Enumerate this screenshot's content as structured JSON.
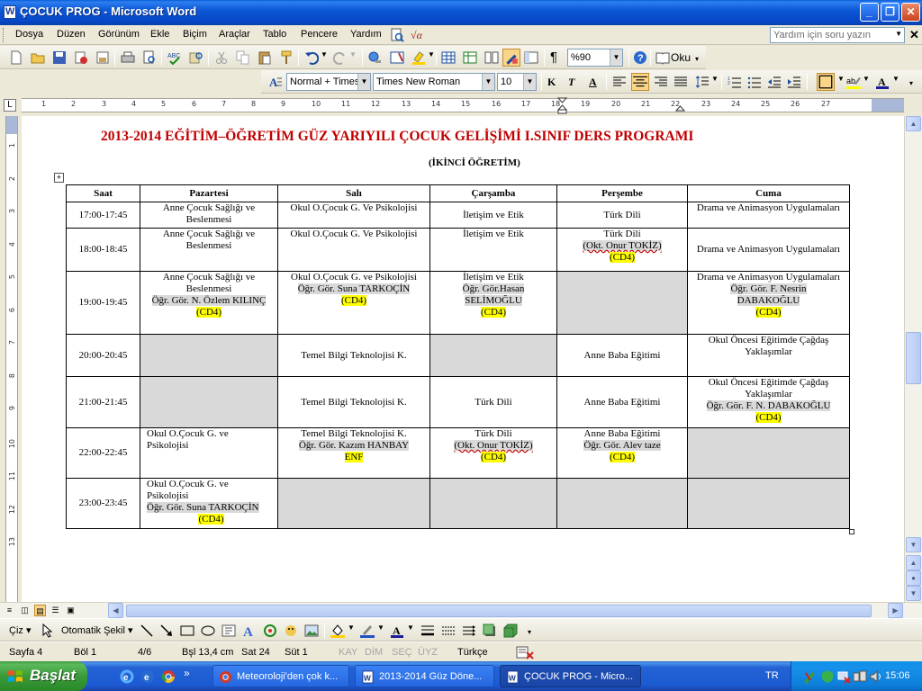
{
  "window": {
    "title": "ÇOCUK PROG - Microsoft Word"
  },
  "menu": {
    "items": [
      "Dosya",
      "Düzen",
      "Görünüm",
      "Ekle",
      "Biçim",
      "Araçlar",
      "Tablo",
      "Pencere",
      "Yardım"
    ],
    "help_placeholder": "Yardım için soru yazın"
  },
  "standard_toolbar": {
    "zoom": "%90",
    "read_label": "Oku"
  },
  "formatting_toolbar": {
    "style": "Normal + Times",
    "font": "Times New Roman",
    "size": "10"
  },
  "ruler": {
    "ticks": [
      "1",
      "2",
      "3",
      "4",
      "5",
      "6",
      "7",
      "8",
      "9",
      "10",
      "11",
      "12",
      "13",
      "14",
      "15",
      "16",
      "17",
      "18",
      "19",
      "20",
      "21",
      "22",
      "23",
      "24",
      "25",
      "26",
      "27"
    ]
  },
  "vruler": {
    "ticks": [
      "1",
      "2",
      "3",
      "4",
      "5",
      "6",
      "7",
      "8",
      "9",
      "10",
      "11",
      "12",
      "13"
    ]
  },
  "document": {
    "title": "2013-2014 EĞİTİM–ÖĞRETİM GÜZ YARIYILI ÇOCUK GELİŞİMİ I.SINIF DERS PROGRAMI",
    "subtitle": "(İKİNCİ ÖĞRETİM)",
    "table": {
      "headers": [
        "Saat",
        "Pazartesi",
        "Salı",
        "Çarşamba",
        "Perşembe",
        "Cuma"
      ],
      "rows": [
        {
          "time": "17:00-17:45",
          "mon": {
            "course": "Anne Çocuk Sağlığı ve Beslenmesi"
          },
          "tue": {
            "course": "Okul O.Çocuk G. Ve Psikolojisi"
          },
          "wed": {
            "course": "İletişim ve Etik"
          },
          "thu": {
            "course": "Türk Dili"
          },
          "fri": {
            "course": "Drama ve Animasyon Uygulamaları"
          }
        },
        {
          "time": "18:00-18:45",
          "mon": {
            "course": "Anne Çocuk Sağlığı ve Beslenmesi"
          },
          "tue": {
            "course": "Okul O.Çocuk G. Ve Psikolojisi"
          },
          "wed": {
            "course": "İletişim ve Etik"
          },
          "thu": {
            "course": "Türk Dili",
            "teacher": "(Okt. Onur TOKİZ)",
            "room": "(CD4)"
          },
          "fri": {
            "course": "Drama ve Animasyon Uygulamaları"
          }
        },
        {
          "time": "19:00-19:45",
          "mon": {
            "course": "Anne Çocuk Sağlığı ve Beslenmesi",
            "teacher": "Öğr. Gör. N. Özlem KILINÇ",
            "room": "(CD4)"
          },
          "tue": {
            "course": "Okul O.Çocuk G. ve Psikolojisi",
            "teacher": "Öğr. Gör. Suna TARKOÇİN",
            "room": "(CD4)"
          },
          "wed": {
            "course": "İletişim ve Etik",
            "teacher": "Öğr. Gör.Hasan SELİMOĞLU",
            "room": "(CD4)"
          },
          "thu": {},
          "fri": {
            "course": "Drama ve Animasyon Uygulamaları",
            "teacher": "Öğr. Gör. F. Nesrin DABAKOĞLU",
            "room": "(CD4)"
          }
        },
        {
          "time": "20:00-20:45",
          "mon": {},
          "tue": {
            "course": "Temel Bilgi Teknolojisi K."
          },
          "wed": {},
          "thu": {
            "course": "Anne Baba Eğitimi"
          },
          "fri": {
            "course": "Okul Öncesi Eğitimde Çağdaş Yaklaşımlar"
          }
        },
        {
          "time": "21:00-21:45",
          "mon": {},
          "tue": {
            "course": "Temel Bilgi Teknolojisi K."
          },
          "wed": {
            "course": "Türk Dili"
          },
          "thu": {
            "course": "Anne Baba Eğitimi"
          },
          "fri": {
            "course": "Okul Öncesi Eğitimde Çağdaş Yaklaşımlar",
            "teacher": "Öğr. Gör. F. N. DABAKOĞLU",
            "room": "(CD4)"
          }
        },
        {
          "time": "22:00-22:45",
          "mon": {
            "course": "Okul O.Çocuk G. ve Psikolojisi"
          },
          "tue": {
            "course": "Temel Bilgi Teknolojisi K.",
            "teacher": "Öğr. Gör. Kazım HANBAY",
            "room": "ENF"
          },
          "wed": {
            "course": "Türk Dili",
            "teacher": "(Okt. Onur TOKİZ)",
            "room": "(CD4)"
          },
          "thu": {
            "course": "Anne Baba Eğitimi",
            "teacher": "Öğr. Gör. Alev taze",
            "room": "(CD4)"
          },
          "fri": {}
        },
        {
          "time": "23:00-23:45",
          "mon": {
            "course": "Okul O.Çocuk G. ve Psikolojisi",
            "teacher": "Öğr. Gör. Suna TARKOÇİN",
            "room": "(CD4)"
          },
          "tue": {},
          "wed": {},
          "thu": {},
          "fri": {}
        }
      ]
    }
  },
  "drawing_toolbar": {
    "draw_label": "Çiz",
    "autoshapes_label": "Otomatik Şekil"
  },
  "status": {
    "page": "Sayfa  4",
    "section": "Böl  1",
    "pages": "4/6",
    "position": "Bşl  13,4 cm",
    "line": "Sat  24",
    "column": "Süt  1",
    "rec": "KAY",
    "trk": "DİM",
    "ext": "SEÇ",
    "ovr": "ÜYZ",
    "language": "Türkçe"
  },
  "taskbar": {
    "start": "Başlat",
    "tasks": [
      "Meteoroloji'den çok k...",
      "2013-2014 Güz Döne...",
      "ÇOCUK PROG - Micro..."
    ],
    "lang": "TR",
    "clock": "15:06"
  }
}
